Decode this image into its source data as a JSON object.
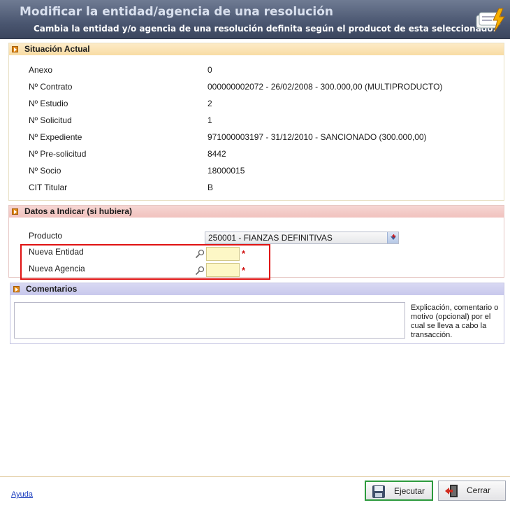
{
  "header": {
    "title": "Modificar la entidad/agencia de una resolución",
    "subtitle": "Cambia la entidad y/o agencia de una resolución definita según el producot de esta seleccionado.",
    "logo_icon": "card-lightning-icon"
  },
  "situacion": {
    "title": "Situación Actual",
    "rows": [
      {
        "label": "Anexo",
        "value": "0"
      },
      {
        "label": "Nº Contrato",
        "value": "000000002072 - 26/02/2008 - 300.000,00 (MULTIPRODUCTO)"
      },
      {
        "label": "Nº Estudio",
        "value": "2"
      },
      {
        "label": "Nº Solicitud",
        "value": "1"
      },
      {
        "label": "Nº Expediente",
        "value": "971000003197 - 31/12/2010 - SANCIONADO (300.000,00)"
      },
      {
        "label": "Nº Pre-solicitud",
        "value": "8442"
      },
      {
        "label": "Nº Socio",
        "value": "18000015"
      },
      {
        "label": "CIT Titular",
        "value": "B"
      }
    ]
  },
  "datos": {
    "title": "Datos a Indicar (si hubiera)",
    "producto_label": "Producto",
    "producto_value": "250001 - FIANZAS DEFINITIVAS",
    "entidad_label": "Nueva Entidad",
    "agencia_label": "Nueva Agencia",
    "required_mark": "*"
  },
  "comentarios": {
    "title": "Comentarios",
    "help": "Explicación, comentario o motivo (opcional) por el cual se lleva a cabo la transacción."
  },
  "footer": {
    "help_link": "Ayuda",
    "execute_label": "Ejecutar",
    "close_label": "Cerrar"
  },
  "colors": {
    "header": "#4a5670",
    "situacion_header": "#f8dca4",
    "datos_header": "#f1c2be",
    "comentarios_header": "#c8c8ec",
    "required": "#d01010",
    "highlight_box": "#e01212"
  }
}
